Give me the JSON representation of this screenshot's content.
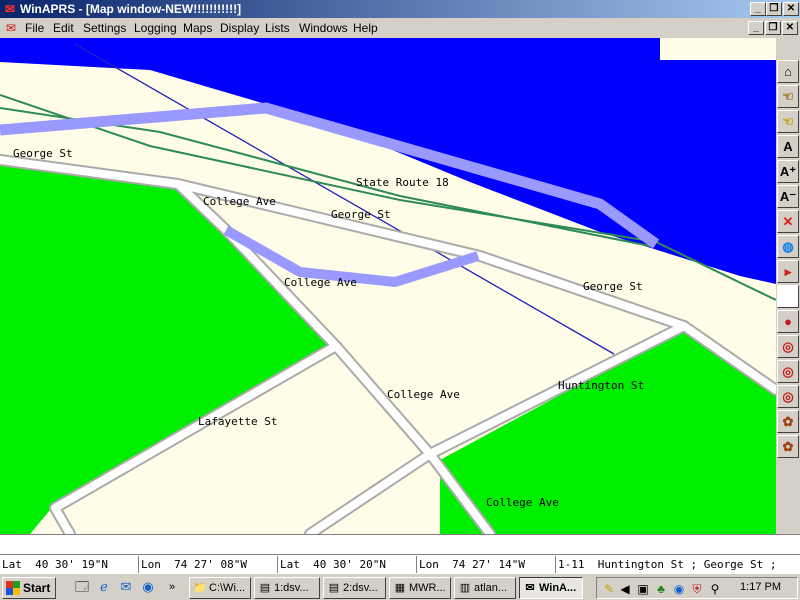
{
  "window": {
    "title": "WinAPRS - [Map window-NEW!!!!!!!!!!!]",
    "app_icon": "winaprs-icon"
  },
  "menu": {
    "items": [
      "File",
      "Edit",
      "Settings",
      "Logging",
      "Maps",
      "Display",
      "Lists",
      "Windows",
      "Help"
    ]
  },
  "map": {
    "colors": {
      "water": "#0000ff",
      "land": "#fffde8",
      "park": "#00ee00",
      "state_route": "#9999ff",
      "railway": "#2e8b57",
      "thin_line": "#2020c0",
      "street": "#ffffff",
      "street_edge": "#aaaaaa"
    },
    "labels": {
      "george_st_1": "George St",
      "state_route_18": "State Route 18",
      "college_ave_1": "College Ave",
      "george_st_2": "George St",
      "college_ave_2": "College Ave",
      "george_st_3": "George St",
      "huntington_st": "Huntington St",
      "college_ave_3": "College Ave",
      "lafayette_st": "Lafayette St",
      "college_ave_4": "College Ave"
    }
  },
  "toolbar": {
    "buttons": [
      {
        "name": "home-icon",
        "glyph": "⌂"
      },
      {
        "name": "hand-icon",
        "glyph": "☜"
      },
      {
        "name": "hand-yellow-icon",
        "glyph": "☜"
      },
      {
        "name": "font-icon",
        "glyph": "A"
      },
      {
        "name": "font-larger-icon",
        "glyph": "A⁺"
      },
      {
        "name": "font-smaller-icon",
        "glyph": "A⁻"
      },
      {
        "name": "delete-icon",
        "glyph": "✕"
      },
      {
        "name": "globe-icon",
        "glyph": "◍"
      },
      {
        "name": "flag-icon",
        "glyph": "▸"
      },
      {
        "name": "blank-icon",
        "glyph": ""
      },
      {
        "name": "balloon-icon",
        "glyph": "●"
      },
      {
        "name": "target-icon-1",
        "glyph": "◎"
      },
      {
        "name": "target-icon-2",
        "glyph": "◎"
      },
      {
        "name": "target-icon-3",
        "glyph": "◎"
      },
      {
        "name": "bug-icon-1",
        "glyph": "✿"
      },
      {
        "name": "bug-icon-2",
        "glyph": "✿"
      }
    ]
  },
  "status": {
    "lat1": "Lat  40 30' 19\"N",
    "lon1": "Lon  74 27' 08\"W",
    "lat2": "Lat  40 30' 20\"N",
    "lon2": "Lon  74 27' 14\"W",
    "info": "1-11  Huntington St ; George St ;"
  },
  "taskbar": {
    "start_label": "Start",
    "tasks": [
      {
        "label": "C:\\Wi...",
        "icon": "folder-icon",
        "active": false
      },
      {
        "label": "1:dsv...",
        "icon": "app-icon",
        "active": false
      },
      {
        "label": "2:dsv...",
        "icon": "app-icon",
        "active": false
      },
      {
        "label": "MWR...",
        "icon": "mwr-icon",
        "active": false
      },
      {
        "label": "atlan...",
        "icon": "doc-icon",
        "active": false
      },
      {
        "label": "WinA...",
        "icon": "winaprs-icon",
        "active": true
      }
    ],
    "clock": "1:17 PM"
  }
}
